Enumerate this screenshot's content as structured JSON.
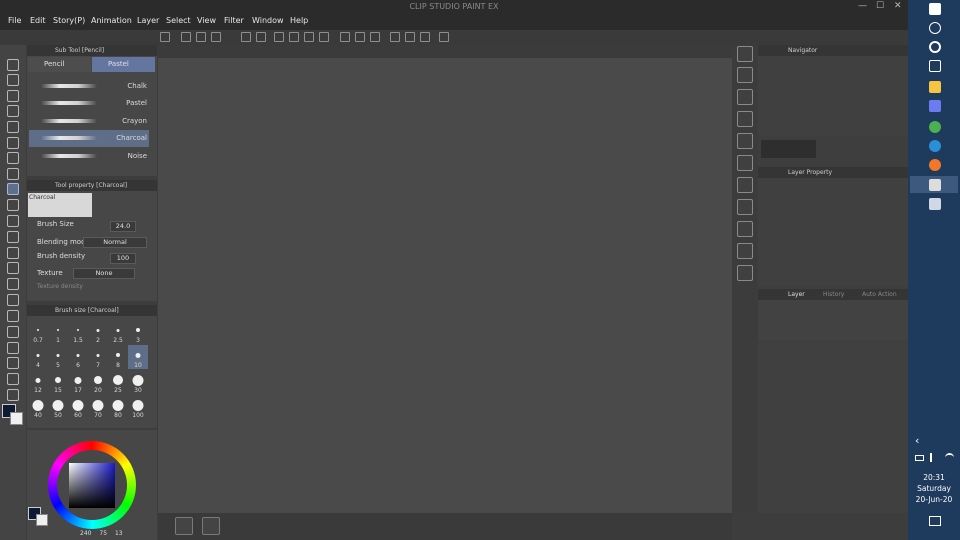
{
  "window": {
    "title": "CLIP STUDIO PAINT EX",
    "minimize": "—",
    "maximize": "☐",
    "close": "✕"
  },
  "menu": [
    "File",
    "Edit",
    "Story(P)",
    "Animation",
    "Layer",
    "Select",
    "View",
    "Filter",
    "Window",
    "Help"
  ],
  "sub_tool": {
    "title": "Sub Tool [Pencil]",
    "tabs": [
      "Pencil",
      "Pastel"
    ],
    "active_tab": "Pastel",
    "brushes": [
      "Chalk",
      "Pastel",
      "Crayon",
      "Charcoal",
      "Noise"
    ],
    "selected_brush": "Charcoal"
  },
  "tool_property": {
    "title": "Tool property [Charcoal]",
    "preview_label": "Charcoal",
    "brush_size_label": "Brush Size",
    "brush_size_value": "24.0",
    "blending_label": "Blending mode",
    "blending_value": "Normal",
    "density_label": "Brush density",
    "density_value": "100",
    "texture_label": "Texture",
    "texture_value": "None",
    "texture_density_label": "Texture density"
  },
  "brush_size": {
    "title": "Brush size [Charcoal]",
    "sizes": [
      "0.7",
      "1",
      "1.5",
      "2",
      "2.5",
      "3",
      "4",
      "5",
      "6",
      "7",
      "8",
      "10",
      "12",
      "15",
      "17",
      "20",
      "25",
      "30",
      "40",
      "50",
      "60",
      "70",
      "80",
      "100"
    ],
    "selected": "10"
  },
  "color": {
    "main": "#0d1a33",
    "sub": "#f0f0f0",
    "readout": {
      "h": "240",
      "s": "75",
      "v": "13"
    }
  },
  "navigator": {
    "title": "Navigator"
  },
  "layer_property": {
    "title": "Layer Property"
  },
  "layer_panel": {
    "tabs": [
      "Layer",
      "History",
      "Auto Action"
    ]
  },
  "taskbar": {
    "time": "20:31",
    "day": "Saturday",
    "date": "20-Jun-20",
    "chevron": "‹"
  }
}
